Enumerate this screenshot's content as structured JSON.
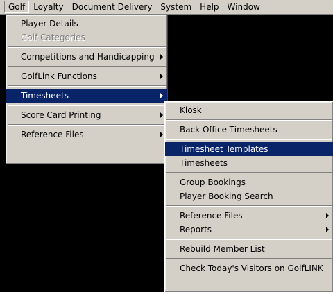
{
  "colors": {
    "menu_background": "#d4d0c8",
    "highlight": "#0a246a",
    "highlight_text": "#ffffff",
    "disabled_text": "#808080",
    "desktop": "#000000"
  },
  "menubar": {
    "items": [
      "Golf",
      "Loyalty",
      "Document Delivery",
      "System",
      "Help",
      "Window"
    ],
    "active_index": 0
  },
  "golf_menu": {
    "items": [
      {
        "label": "Player Details",
        "enabled": true
      },
      {
        "label": "Golf Categories",
        "enabled": false
      },
      {
        "label": "Competitions and Handicapping",
        "submenu": true
      },
      {
        "label": "GolfLink Functions",
        "submenu": true
      },
      {
        "label": "Timesheets",
        "submenu": true,
        "selected": true
      },
      {
        "label": "Score Card Printing",
        "submenu": true
      },
      {
        "label": "Reference Files",
        "submenu": true
      }
    ]
  },
  "timesheets_menu": {
    "items": [
      {
        "label": "Kiosk"
      },
      {
        "label": "Back Office Timesheets"
      },
      {
        "label": "Timesheet Templates",
        "selected": true
      },
      {
        "label": "Timesheets"
      },
      {
        "label": "Group Bookings"
      },
      {
        "label": "Player Booking Search"
      },
      {
        "label": "Reference Files",
        "submenu": true
      },
      {
        "label": "Reports",
        "submenu": true
      },
      {
        "label": "Rebuild Member List"
      },
      {
        "label": "Check Today's Visitors on GolfLINK"
      }
    ]
  }
}
